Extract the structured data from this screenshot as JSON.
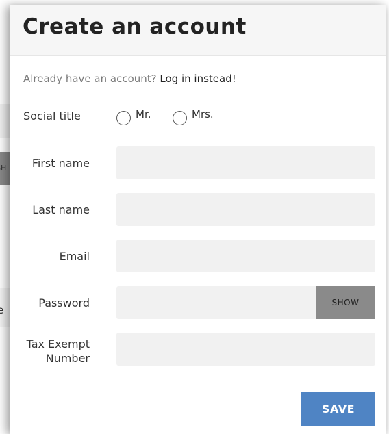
{
  "background": {
    "show_label": "SH",
    "fragment": "e"
  },
  "header": {
    "title": "Create an account"
  },
  "login": {
    "prompt": "Already have an account?",
    "link": "Log in instead!"
  },
  "social_title": {
    "label": "Social title",
    "options": [
      "Mr.",
      "Mrs."
    ]
  },
  "fields": {
    "first_name": {
      "label": "First name",
      "value": ""
    },
    "last_name": {
      "label": "Last name",
      "value": ""
    },
    "email": {
      "label": "Email",
      "value": ""
    },
    "password": {
      "label": "Password",
      "value": "",
      "toggle_label": "SHOW"
    },
    "tax_exempt": {
      "label_line1": "Tax Exempt",
      "label_line2": "Number",
      "value": ""
    }
  },
  "actions": {
    "save_label": "SAVE"
  },
  "colors": {
    "accent": "#4f84c4",
    "show_button": "#8a8a8a",
    "field_bg": "#f1f1f1",
    "header_bg": "#f6f6f6"
  }
}
